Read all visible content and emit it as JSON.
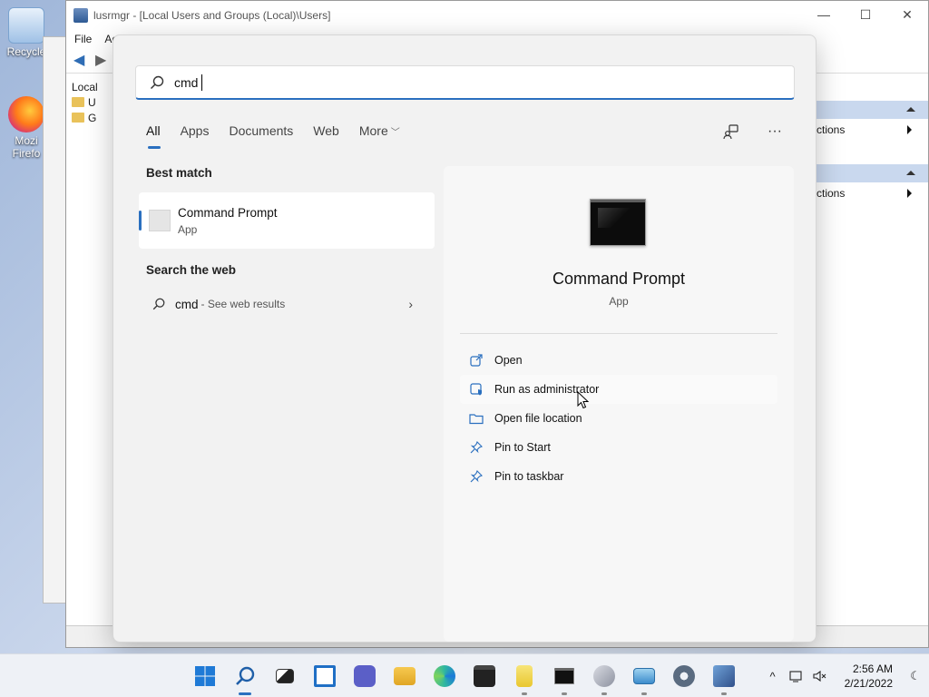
{
  "desktop": {
    "icons": [
      {
        "label": "Recycle",
        "icon": "recycle-bin-icon"
      },
      {
        "label": "Mozi\nFirefo",
        "icon": "firefox-icon"
      }
    ]
  },
  "background_window": {
    "title": "lusrmgr - [Local Users and Groups (Local)\\Users]",
    "menu": [
      "File",
      "Acti"
    ],
    "tree": [
      "Local",
      "U",
      "G"
    ],
    "actions": [
      "ctions",
      "ctions"
    ],
    "controls": {
      "minimize": "—",
      "maximize": "☐",
      "close": "✕"
    }
  },
  "search": {
    "query": "cmd",
    "tabs": [
      {
        "label": "All",
        "active": true
      },
      {
        "label": "Apps"
      },
      {
        "label": "Documents"
      },
      {
        "label": "Web"
      },
      {
        "label": "More",
        "has_dropdown": true
      }
    ],
    "more_options": "···",
    "best_match_title": "Best match",
    "best_match": {
      "name": "Command Prompt",
      "type": "App"
    },
    "web_title": "Search the web",
    "web_result": {
      "query": "cmd",
      "suffix": "- See web results"
    },
    "details": {
      "name": "Command Prompt",
      "type": "App",
      "actions": [
        {
          "label": "Open",
          "icon": "open-external-icon"
        },
        {
          "label": "Run as administrator",
          "icon": "shield-admin-icon"
        },
        {
          "label": "Open file location",
          "icon": "folder-icon"
        },
        {
          "label": "Pin to Start",
          "icon": "pin-icon"
        },
        {
          "label": "Pin to taskbar",
          "icon": "pin-icon"
        }
      ]
    }
  },
  "taskbar": {
    "apps": [
      "start",
      "search",
      "task-view",
      "widgets",
      "teams-chat",
      "file-explorer",
      "edge",
      "store",
      "notepad",
      "terminal",
      "computer-management",
      "lusrmgr-tool",
      "settings",
      "admin-tools"
    ],
    "time": "2:56 AM",
    "date": "2/21/2022",
    "tray_chevron": "^"
  },
  "colors": {
    "accent": "#2a6fbf",
    "flyout_bg": "#f2f2f2"
  }
}
